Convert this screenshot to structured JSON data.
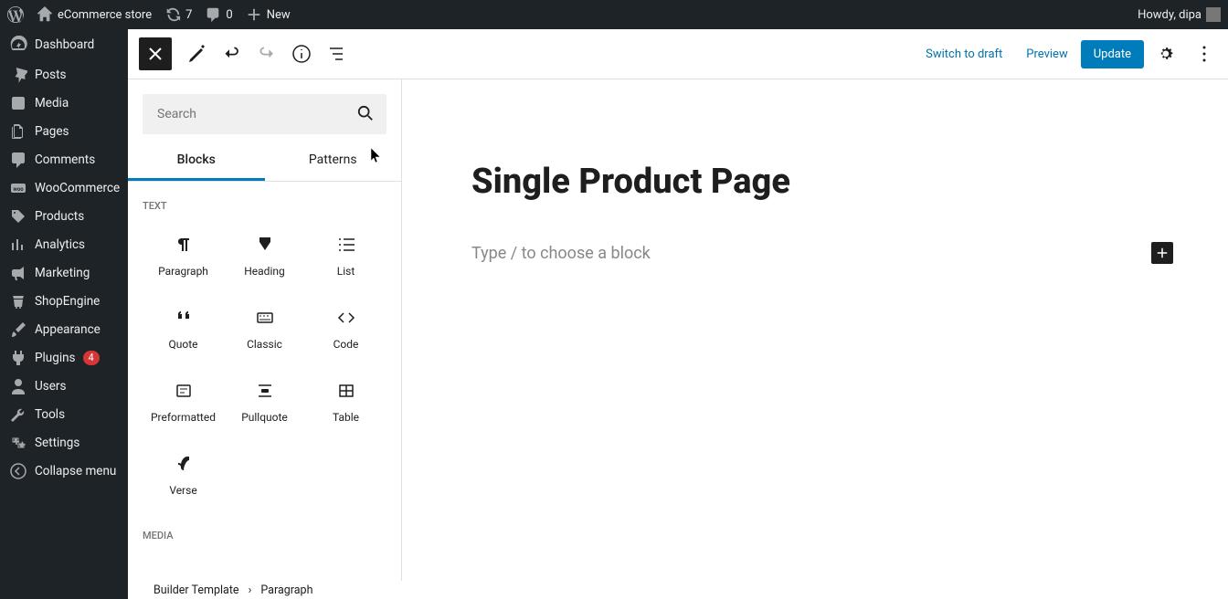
{
  "adminbar": {
    "site_name": "eCommerce store",
    "refresh_count": "7",
    "comments_count": "0",
    "new_label": "New",
    "howdy": "Howdy, dipa"
  },
  "sidebar": {
    "items": [
      {
        "label": "Dashboard",
        "icon": "dashboard"
      },
      {
        "label": "Posts",
        "icon": "pin"
      },
      {
        "label": "Media",
        "icon": "media"
      },
      {
        "label": "Pages",
        "icon": "pages"
      },
      {
        "label": "Comments",
        "icon": "comments"
      },
      {
        "label": "WooCommerce",
        "icon": "woo"
      },
      {
        "label": "Products",
        "icon": "products"
      },
      {
        "label": "Analytics",
        "icon": "analytics"
      },
      {
        "label": "Marketing",
        "icon": "marketing"
      },
      {
        "label": "ShopEngine",
        "icon": "shopengine"
      },
      {
        "label": "Appearance",
        "icon": "brush"
      },
      {
        "label": "Plugins",
        "icon": "plugins",
        "badge": "4"
      },
      {
        "label": "Users",
        "icon": "users"
      },
      {
        "label": "Tools",
        "icon": "tools"
      },
      {
        "label": "Settings",
        "icon": "settings"
      },
      {
        "label": "Collapse menu",
        "icon": "collapse"
      }
    ]
  },
  "toolbar": {
    "switch_draft": "Switch to draft",
    "preview": "Preview",
    "update": "Update"
  },
  "inserter": {
    "search_placeholder": "Search",
    "tabs": {
      "blocks": "Blocks",
      "patterns": "Patterns"
    },
    "sections": {
      "text": {
        "title": "TEXT",
        "blocks": [
          "Paragraph",
          "Heading",
          "List",
          "Quote",
          "Classic",
          "Code",
          "Preformatted",
          "Pullquote",
          "Table",
          "Verse"
        ]
      },
      "media": {
        "title": "MEDIA"
      }
    }
  },
  "canvas": {
    "title": "Single Product Page",
    "placeholder": "Type / to choose a block"
  },
  "footer": {
    "crumb1": "Builder Template",
    "crumb2": "Paragraph"
  }
}
